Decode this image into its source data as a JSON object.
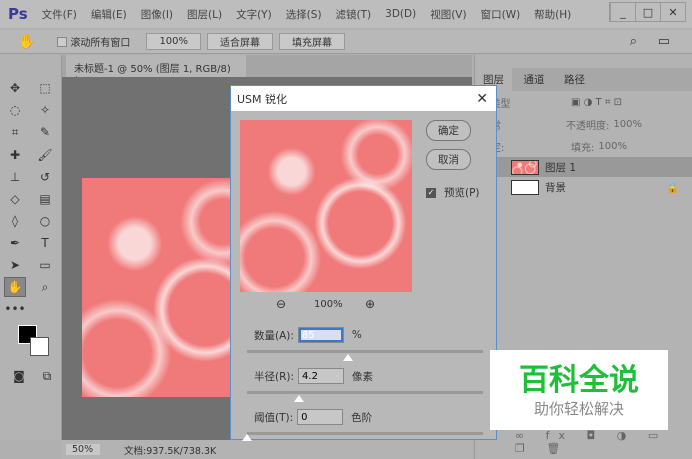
{
  "app": {
    "logo": "Ps",
    "menus": [
      "文件(F)",
      "编辑(E)",
      "图像(I)",
      "图层(L)",
      "文字(Y)",
      "选择(S)",
      "滤镜(T)",
      "3D(D)",
      "视图(V)",
      "窗口(W)",
      "帮助(H)"
    ],
    "win": [
      "_",
      "□",
      "✕"
    ]
  },
  "options": {
    "scroll_all": "滚动所有窗口",
    "zoom100": "100%",
    "fit": "适合屏幕",
    "fill": "填充屏幕"
  },
  "doc": {
    "tab": "未标题-1 @ 50% (图层 1, RGB/8) *",
    "close": "×"
  },
  "status": {
    "zoom": "50%",
    "doc": "文档:937.5K/738.3K"
  },
  "panel": {
    "tabs": [
      "图层",
      "通道",
      "路径"
    ],
    "kind": "ρ 类型",
    "blend": "正常",
    "opacity_label": "不透明度:",
    "opacity": "100%",
    "lock_label": "锁定:",
    "fill_label": "填充:",
    "fill": "100%",
    "layers": [
      {
        "name": "图层 1"
      },
      {
        "name": "背景"
      }
    ]
  },
  "dialog": {
    "title": "USM 锐化",
    "ok": "确定",
    "cancel": "取消",
    "preview": "预览(P)",
    "zoom": "100%",
    "amount": {
      "label": "数量(A):",
      "value": "85",
      "unit": "%",
      "slider": 0.43
    },
    "radius": {
      "label": "半径(R):",
      "value": "4.2",
      "unit": "像素",
      "slider": 0.22
    },
    "threshold": {
      "label": "阈值(T):",
      "value": "0",
      "unit": "色阶",
      "slider": 0
    }
  },
  "watermark": {
    "title": "百科全说",
    "subtitle": "助你轻松解决"
  }
}
